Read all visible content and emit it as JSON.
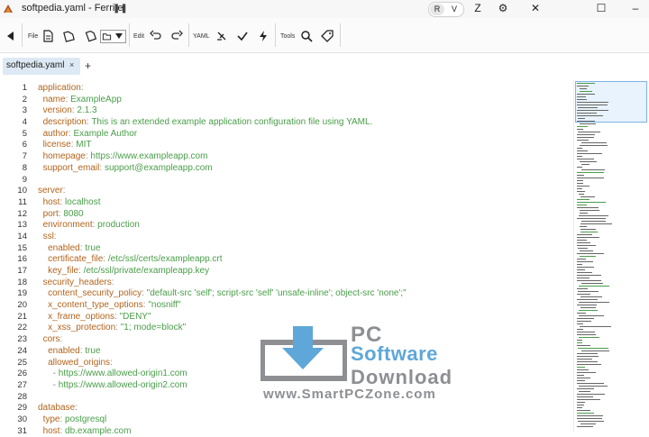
{
  "window": {
    "title": "softpedia.yaml - Ferrite",
    "mode_buttons": [
      "R",
      "V"
    ],
    "extra_buttons": [
      "Z"
    ]
  },
  "toolbar": {
    "groups": [
      "File",
      "Edit",
      "YAML",
      "Tools"
    ]
  },
  "tabs": {
    "active": "softpedia.yaml",
    "close": "×",
    "add": "+"
  },
  "editor": {
    "lines": [
      {
        "n": "1",
        "indent": "",
        "key": "application",
        "sep": ":",
        "val": ""
      },
      {
        "n": "2",
        "indent": "  ",
        "key": "name",
        "sep": ": ",
        "val": "ExampleApp"
      },
      {
        "n": "3",
        "indent": "  ",
        "key": "version",
        "sep": ": ",
        "val": "2.1.3"
      },
      {
        "n": "4",
        "indent": "  ",
        "key": "description",
        "sep": ": ",
        "val": "This is an extended example application configuration file using YAML."
      },
      {
        "n": "5",
        "indent": "  ",
        "key": "author",
        "sep": ": ",
        "val": "Example Author"
      },
      {
        "n": "6",
        "indent": "  ",
        "key": "license",
        "sep": ": ",
        "val": "MIT"
      },
      {
        "n": "7",
        "indent": "  ",
        "key": "homepage",
        "sep": ": ",
        "val": "https://www.exampleapp.com"
      },
      {
        "n": "8",
        "indent": "  ",
        "key": "support_email",
        "sep": ": ",
        "val": "support@exampleapp.com"
      },
      {
        "n": "9",
        "indent": "",
        "key": "",
        "sep": "",
        "val": ""
      },
      {
        "n": "10",
        "indent": "",
        "key": "server",
        "sep": ":",
        "val": ""
      },
      {
        "n": "11",
        "indent": "  ",
        "key": "host",
        "sep": ": ",
        "val": "localhost"
      },
      {
        "n": "12",
        "indent": "  ",
        "key": "port",
        "sep": ": ",
        "val": "8080"
      },
      {
        "n": "13",
        "indent": "  ",
        "key": "environment",
        "sep": ": ",
        "val": "production"
      },
      {
        "n": "14",
        "indent": "  ",
        "key": "ssl",
        "sep": ":",
        "val": ""
      },
      {
        "n": "15",
        "indent": "    ",
        "key": "enabled",
        "sep": ": ",
        "val": "true"
      },
      {
        "n": "16",
        "indent": "    ",
        "key": "certificate_file",
        "sep": ": ",
        "val": "/etc/ssl/certs/exampleapp.crt"
      },
      {
        "n": "17",
        "indent": "    ",
        "key": "key_file",
        "sep": ": ",
        "val": "/etc/ssl/private/exampleapp.key"
      },
      {
        "n": "18",
        "indent": "  ",
        "key": "security_headers",
        "sep": ":",
        "val": ""
      },
      {
        "n": "19",
        "indent": "    ",
        "key": "content_security_policy",
        "sep": ": ",
        "val": "\"default-src 'self'; script-src 'self' 'unsafe-inline'; object-src 'none';\""
      },
      {
        "n": "20",
        "indent": "    ",
        "key": "x_content_type_options",
        "sep": ": ",
        "val": "\"nosniff\""
      },
      {
        "n": "21",
        "indent": "    ",
        "key": "x_frame_options",
        "sep": ": ",
        "val": "\"DENY\""
      },
      {
        "n": "22",
        "indent": "    ",
        "key": "x_xss_protection",
        "sep": ": ",
        "val": "\"1; mode=block\""
      },
      {
        "n": "23",
        "indent": "  ",
        "key": "cors",
        "sep": ":",
        "val": ""
      },
      {
        "n": "24",
        "indent": "    ",
        "key": "enabled",
        "sep": ": ",
        "val": "true"
      },
      {
        "n": "25",
        "indent": "    ",
        "key": "allowed_origins",
        "sep": ":",
        "val": ""
      },
      {
        "n": "26",
        "indent": "      ",
        "key": "",
        "sep": "- ",
        "val": "https://www.allowed-origin1.com"
      },
      {
        "n": "27",
        "indent": "      ",
        "key": "",
        "sep": "- ",
        "val": "https://www.allowed-origin2.com"
      },
      {
        "n": "28",
        "indent": "",
        "key": "",
        "sep": "",
        "val": ""
      },
      {
        "n": "29",
        "indent": "",
        "key": "database",
        "sep": ":",
        "val": ""
      },
      {
        "n": "30",
        "indent": "  ",
        "key": "type",
        "sep": ": ",
        "val": "postgresql"
      },
      {
        "n": "31",
        "indent": "  ",
        "key": "host",
        "sep": ": ",
        "val": "db.example.com"
      }
    ]
  },
  "watermark": {
    "line1": "PC",
    "line2": "Software",
    "line3": "Download",
    "url": "www.SmartPCZone.com"
  },
  "colors": {
    "key": "#b2641c",
    "value": "#4a9d4a",
    "tab_active": "#dde9f4",
    "minimap_view": "#7fb3e6"
  },
  "icons": {
    "app": "ferrite-logo-icon",
    "pause": "pause-icon",
    "settings": "gear-icon",
    "close": "close-icon",
    "maximize": "maximize-icon",
    "minimize": "minimize-icon"
  }
}
